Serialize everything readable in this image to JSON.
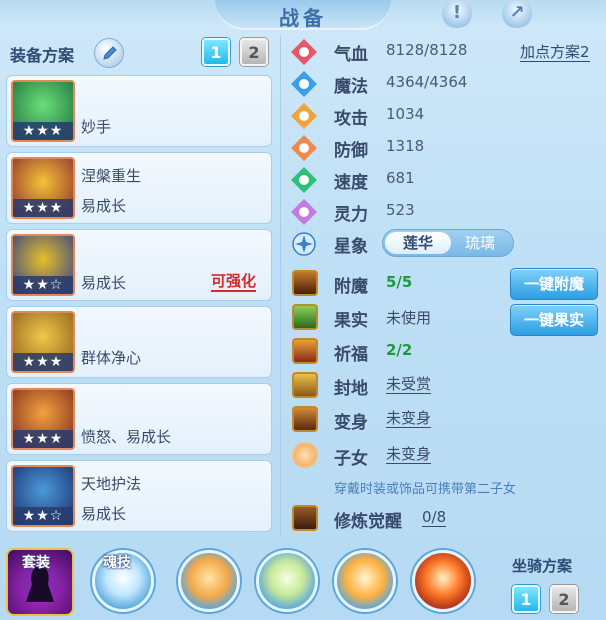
{
  "header": {
    "title": "战备"
  },
  "top_icons": [
    {
      "name": "info-icon",
      "glyph": "!"
    },
    {
      "name": "share-icon",
      "glyph": "↗"
    }
  ],
  "equip_panel": {
    "label": "装备方案",
    "tabs": [
      "1",
      "2"
    ],
    "active_tab": "1",
    "slots": [
      {
        "name": "妙手",
        "tag": "",
        "stars": "★★★",
        "upgrade": "",
        "colors": [
          "#1d6b3a",
          "#6adf7a"
        ]
      },
      {
        "name": "涅槃重生",
        "tag": "易成长",
        "stars": "★★★",
        "upgrade": "",
        "colors": [
          "#8a2a2a",
          "#f5c23a"
        ]
      },
      {
        "name": "",
        "tag": "易成长",
        "stars": "★★☆",
        "upgrade": "可强化",
        "colors": [
          "#2a3a8a",
          "#e6c02a"
        ]
      },
      {
        "name": "群体净心",
        "tag": "",
        "stars": "★★★",
        "upgrade": "",
        "colors": [
          "#8a5a1a",
          "#f0c84a"
        ]
      },
      {
        "name": "",
        "tag": "愤怒、易成长",
        "stars": "★★★",
        "upgrade": "",
        "colors": [
          "#7a2a1a",
          "#f5a040"
        ]
      },
      {
        "name": "天地护法",
        "tag": "易成长",
        "stars": "★★☆",
        "upgrade": "",
        "colors": [
          "#1a2a6a",
          "#4a9ad8"
        ]
      }
    ]
  },
  "stats": {
    "add_plan_label": "加点方案2",
    "rows": [
      {
        "label": "气血",
        "value": "8128/8128",
        "color": "#e8556a",
        "icon": "heart-icon"
      },
      {
        "label": "魔法",
        "value": "4364/4364",
        "color": "#3aa0e6",
        "icon": "mana-diamond-icon"
      },
      {
        "label": "攻击",
        "value": "1034",
        "color": "#f2a23a",
        "icon": "sword-icon"
      },
      {
        "label": "防御",
        "value": "1318",
        "color": "#f08a4a",
        "icon": "shield-icon"
      },
      {
        "label": "速度",
        "value": "681",
        "color": "#2cc07a",
        "icon": "lightning-icon"
      },
      {
        "label": "灵力",
        "value": "523",
        "color": "#c27ae6",
        "icon": "spirit-icon"
      }
    ],
    "star_phase": {
      "label": "星象",
      "options": [
        "莲华",
        "琉璃"
      ],
      "selected": "莲华"
    }
  },
  "buffs": {
    "rows": [
      {
        "label": "附魔",
        "value": "5/5",
        "style": "green",
        "icon": "enchant-icon"
      },
      {
        "label": "果实",
        "value": "未使用",
        "style": "plain",
        "icon": "fruit-icon"
      },
      {
        "label": "祈福",
        "value": "2/2",
        "style": "green",
        "icon": "blessing-icon"
      },
      {
        "label": "封地",
        "value": "未受赏",
        "style": "ul",
        "icon": "fief-icon"
      },
      {
        "label": "变身",
        "value": "未变身",
        "style": "ul",
        "icon": "transform-icon"
      },
      {
        "label": "子女",
        "value": "未变身",
        "style": "ul",
        "icon": "child-icon"
      }
    ],
    "one_key_enchant": "一键附魔",
    "one_key_fruit": "一键果实",
    "hint": "穿戴时装或饰品可携带第二子女",
    "cultivation": {
      "label": "修炼觉醒",
      "value": "0/8"
    }
  },
  "bottom": {
    "suit_label": "套装",
    "soul_skill_label": "魂技",
    "mount_label": "坐骑方案",
    "mount_tabs": [
      "1",
      "2"
    ],
    "active_mount_tab": "1"
  }
}
